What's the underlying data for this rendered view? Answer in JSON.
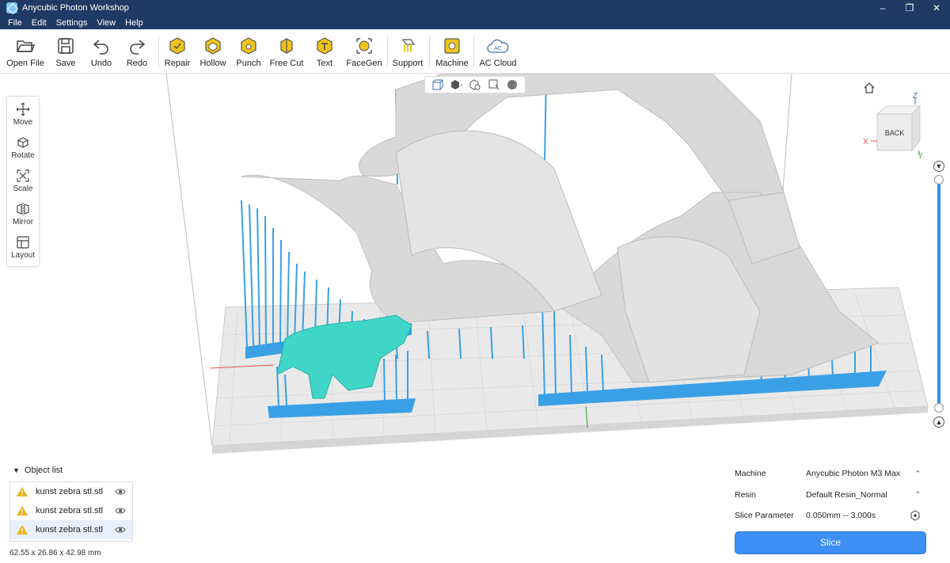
{
  "window": {
    "title": "Anycubic Photon Workshop"
  },
  "menu": {
    "items": [
      "File",
      "Edit",
      "Settings",
      "View",
      "Help"
    ]
  },
  "toolbar": {
    "file_tools": [
      {
        "label": "Open File",
        "icon": "folder-open-icon"
      },
      {
        "label": "Save",
        "icon": "save-icon"
      },
      {
        "label": "Undo",
        "icon": "undo-icon"
      },
      {
        "label": "Redo",
        "icon": "redo-icon"
      }
    ],
    "model_tools": [
      {
        "label": "Repair",
        "icon": "repair-icon"
      },
      {
        "label": "Hollow",
        "icon": "hollow-icon"
      },
      {
        "label": "Punch",
        "icon": "punch-icon"
      },
      {
        "label": "Free Cut",
        "icon": "free-cut-icon"
      },
      {
        "label": "Text",
        "icon": "text-icon"
      },
      {
        "label": "FaceGen",
        "icon": "facegen-icon"
      }
    ],
    "support": {
      "label": "Support",
      "icon": "support-icon"
    },
    "machine": {
      "label": "Machine",
      "icon": "machine-icon"
    },
    "cloud": {
      "label": "AC Cloud",
      "icon": "ac-cloud-icon",
      "badge": "AC"
    }
  },
  "side_tools": [
    "Move",
    "Rotate",
    "Scale",
    "Mirror",
    "Layout"
  ],
  "view_cube": {
    "face": "BACK",
    "axes": {
      "x": "X",
      "y": "Y",
      "z": "Z"
    }
  },
  "object_list": {
    "title": "Object list",
    "items": [
      {
        "name": "kunst zebra stl.stl",
        "selected": false
      },
      {
        "name": "kunst zebra stl.stl",
        "selected": false
      },
      {
        "name": "kunst zebra stl.stl",
        "selected": true
      }
    ],
    "dimensions": "62.55 x 26.86 x 42.98 mm"
  },
  "print_settings": {
    "machine_label": "Machine",
    "machine_value": "Anycubic Photon M3 Max",
    "resin_label": "Resin",
    "resin_value": "Default Resin_Normal",
    "slice_label": "Slice Parameter",
    "slice_value": "0.050mm -- 3.000s"
  },
  "slice_button": "Slice",
  "colors": {
    "titlebar": "#1f3a64",
    "accent": "#3d8ef5",
    "support": "#3aa0e6",
    "model": "#d9d9d9",
    "selected_model": "#3fd6c8",
    "toolbar_icon": "#f0c419"
  }
}
